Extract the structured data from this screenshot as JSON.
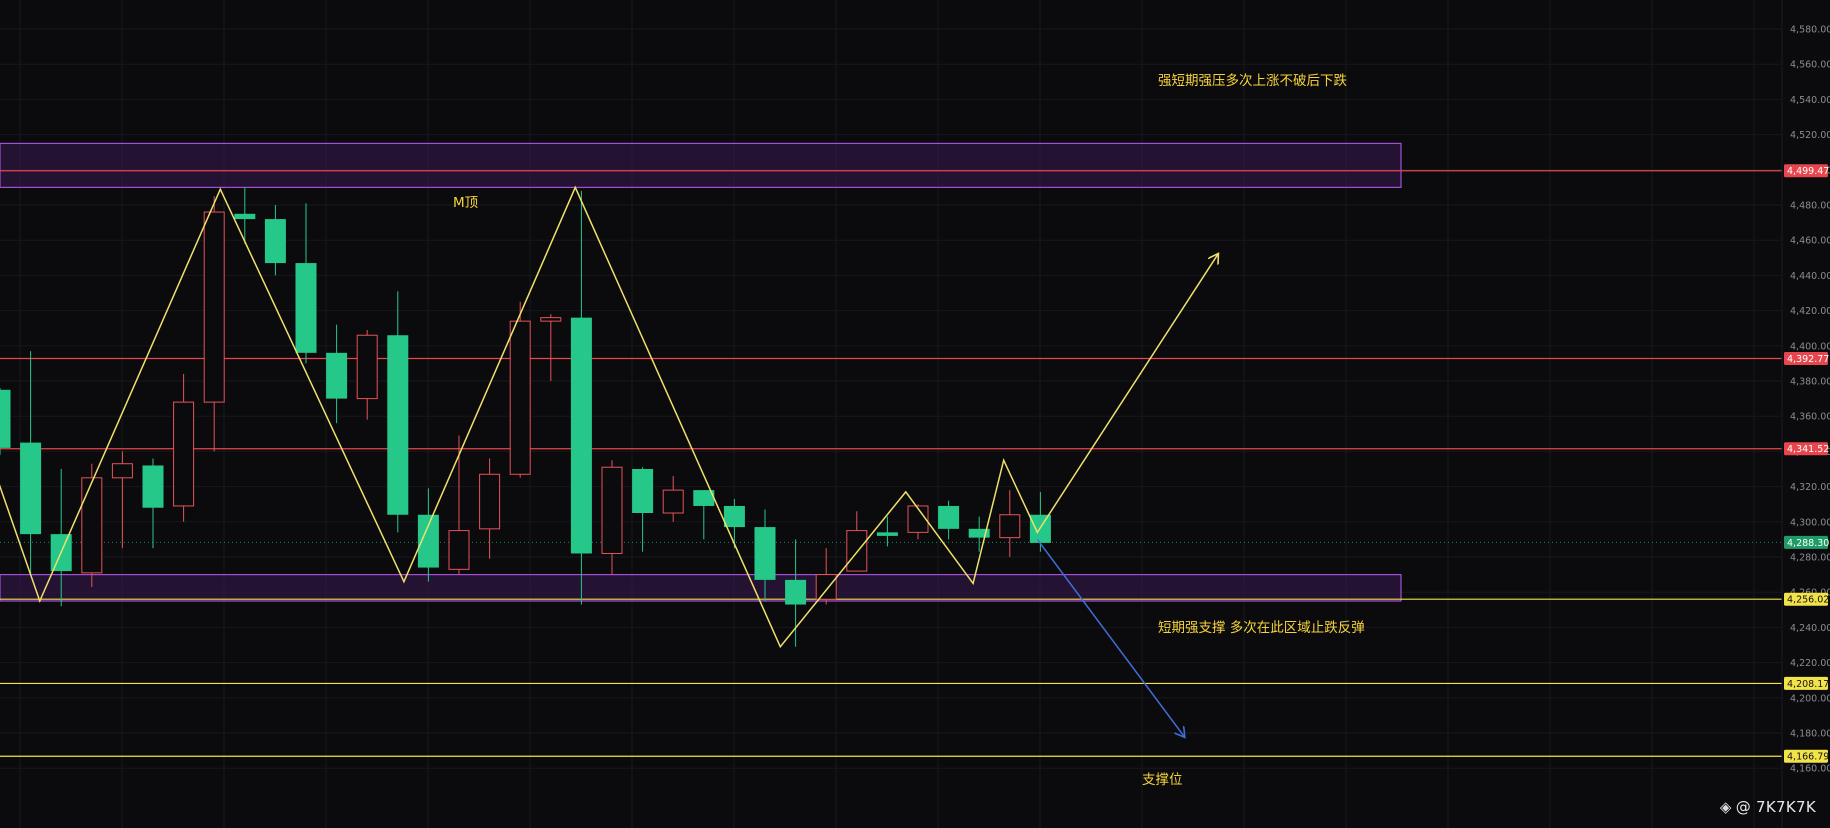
{
  "colors": {
    "background": "#0b0b0d",
    "grid": "#16181d",
    "up": "#e4535a",
    "down": "#26c88a",
    "zone_fill": "#3a1a52",
    "zone_border": "#a24fd6",
    "resistance_line": "#e8464f",
    "support_line": "#f2e34a",
    "annotation": "#f5d33a",
    "zigzag": "#f0e06b",
    "arrow_down": "#3f6fd8",
    "current_line": "#1e8a5a"
  },
  "watermark": {
    "icon": "binance-logo-icon",
    "text": "@ 7K7K7K"
  },
  "annotations": {
    "resistance_note": "强短期强压多次上涨不破后下跌",
    "m_top": "M顶",
    "support_note": "短期强支撑 多次在此区域止跌反弹",
    "support_level": "支撑位"
  },
  "chart_data": {
    "type": "candlestick",
    "yaxis": {
      "position": "right",
      "ticks": [
        4580,
        4560,
        4540,
        4520,
        4500,
        4480,
        4460,
        4440,
        4420,
        4400,
        4380,
        4360,
        4340,
        4320,
        4300,
        4280,
        4260,
        4240,
        4220,
        4200,
        4180,
        4160
      ],
      "tick_labels": [
        "4,580.00",
        "4,560.00",
        "4,540.00",
        "4,520.00",
        "4,500.00",
        "4,480.00",
        "4,460.00",
        "4,440.00",
        "4,420.00",
        "4,400.00",
        "4,380.00",
        "4,360.00",
        "4,340.00",
        "4,320.00",
        "4,300.00",
        "4,280.00",
        "4,260.00",
        "4,240.00",
        "4,220.00",
        "4,200.00",
        "4,180.00",
        "4,160.00"
      ],
      "range": [
        4150,
        4592
      ]
    },
    "grid": true,
    "candles": [
      {
        "o": 4375,
        "h": 4376,
        "l": 4338,
        "c": 4342
      },
      {
        "o": 4345,
        "h": 4397,
        "l": 4270,
        "c": 4293
      },
      {
        "o": 4293,
        "h": 4330,
        "l": 4252,
        "c": 4272
      },
      {
        "o": 4271,
        "h": 4333,
        "l": 4263,
        "c": 4325
      },
      {
        "o": 4325,
        "h": 4340,
        "l": 4285,
        "c": 4333
      },
      {
        "o": 4332,
        "h": 4336,
        "l": 4285,
        "c": 4308
      },
      {
        "o": 4309,
        "h": 4384,
        "l": 4300,
        "c": 4368
      },
      {
        "o": 4368,
        "h": 4485,
        "l": 4340,
        "c": 4476
      },
      {
        "o": 4475,
        "h": 4490,
        "l": 4458,
        "c": 4472
      },
      {
        "o": 4472,
        "h": 4480,
        "l": 4440,
        "c": 4447
      },
      {
        "o": 4447,
        "h": 4481,
        "l": 4390,
        "c": 4396
      },
      {
        "o": 4396,
        "h": 4412,
        "l": 4356,
        "c": 4370
      },
      {
        "o": 4370,
        "h": 4409,
        "l": 4358,
        "c": 4406
      },
      {
        "o": 4406,
        "h": 4431,
        "l": 4294,
        "c": 4304
      },
      {
        "o": 4304,
        "h": 4319,
        "l": 4266,
        "c": 4274
      },
      {
        "o": 4273,
        "h": 4349,
        "l": 4270,
        "c": 4295
      },
      {
        "o": 4296,
        "h": 4336,
        "l": 4279,
        "c": 4327
      },
      {
        "o": 4327,
        "h": 4425,
        "l": 4325,
        "c": 4414
      },
      {
        "o": 4414,
        "h": 4418,
        "l": 4380,
        "c": 4416
      },
      {
        "o": 4416,
        "h": 4488,
        "l": 4253,
        "c": 4282
      },
      {
        "o": 4282,
        "h": 4335,
        "l": 4270,
        "c": 4331
      },
      {
        "o": 4330,
        "h": 4331,
        "l": 4283,
        "c": 4305
      },
      {
        "o": 4305,
        "h": 4326,
        "l": 4300,
        "c": 4318
      },
      {
        "o": 4318,
        "h": 4318,
        "l": 4290,
        "c": 4309
      },
      {
        "o": 4309,
        "h": 4313,
        "l": 4285,
        "c": 4297
      },
      {
        "o": 4297,
        "h": 4307,
        "l": 4255,
        "c": 4267
      },
      {
        "o": 4267,
        "h": 4290,
        "l": 4229,
        "c": 4253
      },
      {
        "o": 4256,
        "h": 4285,
        "l": 4253,
        "c": 4270
      },
      {
        "o": 4272,
        "h": 4306,
        "l": 4272,
        "c": 4295
      },
      {
        "o": 4294,
        "h": 4303,
        "l": 4286,
        "c": 4292
      },
      {
        "o": 4294,
        "h": 4310,
        "l": 4290,
        "c": 4309
      },
      {
        "o": 4309,
        "h": 4312,
        "l": 4290,
        "c": 4296
      },
      {
        "o": 4296,
        "h": 4303,
        "l": 4283,
        "c": 4291
      },
      {
        "o": 4291,
        "h": 4318,
        "l": 4280,
        "c": 4304
      },
      {
        "o": 4304,
        "h": 4317,
        "l": 4283,
        "c": 4288
      }
    ],
    "price_lines": [
      {
        "value": 4499.47,
        "label": "4,499.47",
        "color": "#e8464f"
      },
      {
        "value": 4392.77,
        "label": "4,392.77",
        "color": "#e8464f"
      },
      {
        "value": 4341.52,
        "label": "4,341.52",
        "color": "#e8464f"
      },
      {
        "value": 4256.02,
        "label": "4,256.02",
        "color": "#f2e34a"
      },
      {
        "value": 4208.17,
        "label": "4,208.17",
        "color": "#f2e34a"
      },
      {
        "value": 4166.79,
        "label": "4,166.79",
        "color": "#f2e34a"
      }
    ],
    "current_price": {
      "value": 4288.3,
      "label": "4,288.30"
    },
    "zones": [
      {
        "from": 4490,
        "to": 4515
      },
      {
        "from": 4255,
        "to": 4270
      }
    ],
    "zigzag": [
      {
        "i": -0.5,
        "p": 4345
      },
      {
        "i": 1.3,
        "p": 4255
      },
      {
        "i": 7.2,
        "p": 4489
      },
      {
        "i": 13.2,
        "p": 4266
      },
      {
        "i": 18.8,
        "p": 4490
      },
      {
        "i": 25.5,
        "p": 4229
      },
      {
        "i": 29.6,
        "p": 4317
      },
      {
        "i": 31.8,
        "p": 4265
      },
      {
        "i": 32.8,
        "p": 4335
      },
      {
        "i": 33.9,
        "p": 4294
      },
      {
        "i": 39.8,
        "p": 4452
      }
    ],
    "arrow_down": [
      {
        "i": 33.9,
        "p": 4290
      },
      {
        "i": 38.7,
        "p": 4178
      }
    ]
  }
}
